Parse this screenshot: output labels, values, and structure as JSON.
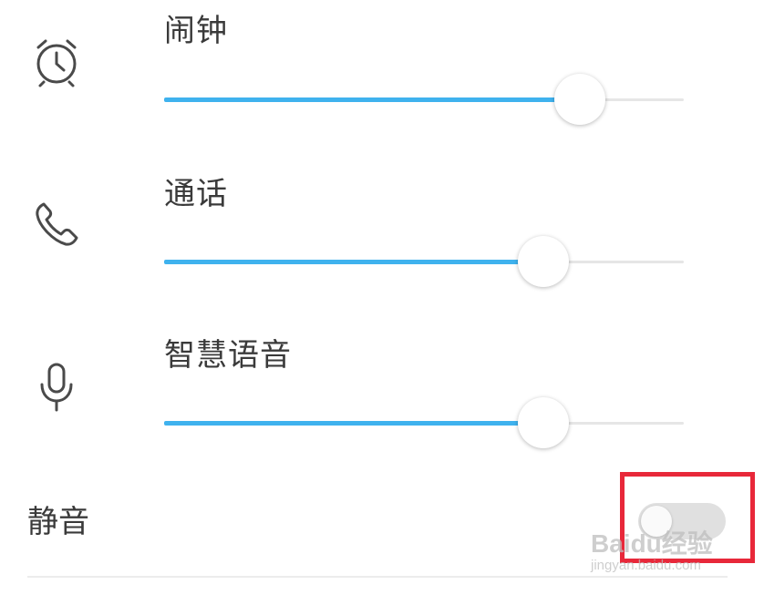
{
  "volume_rows": [
    {
      "id": "alarm",
      "label": "闹钟",
      "icon": "alarm-clock-icon",
      "level": 0.8
    },
    {
      "id": "call",
      "label": "通话",
      "icon": "phone-icon",
      "level": 0.73
    },
    {
      "id": "voice",
      "label": "智慧语音",
      "icon": "microphone-icon",
      "level": 0.73
    }
  ],
  "mute": {
    "label": "静音",
    "enabled": false
  },
  "watermark": {
    "main": "Baidu经验",
    "sub": "jingyan.baidu.com"
  },
  "colors": {
    "accent": "#3fb2ee",
    "track": "#e6e6e6",
    "highlight": "#e8283a"
  }
}
